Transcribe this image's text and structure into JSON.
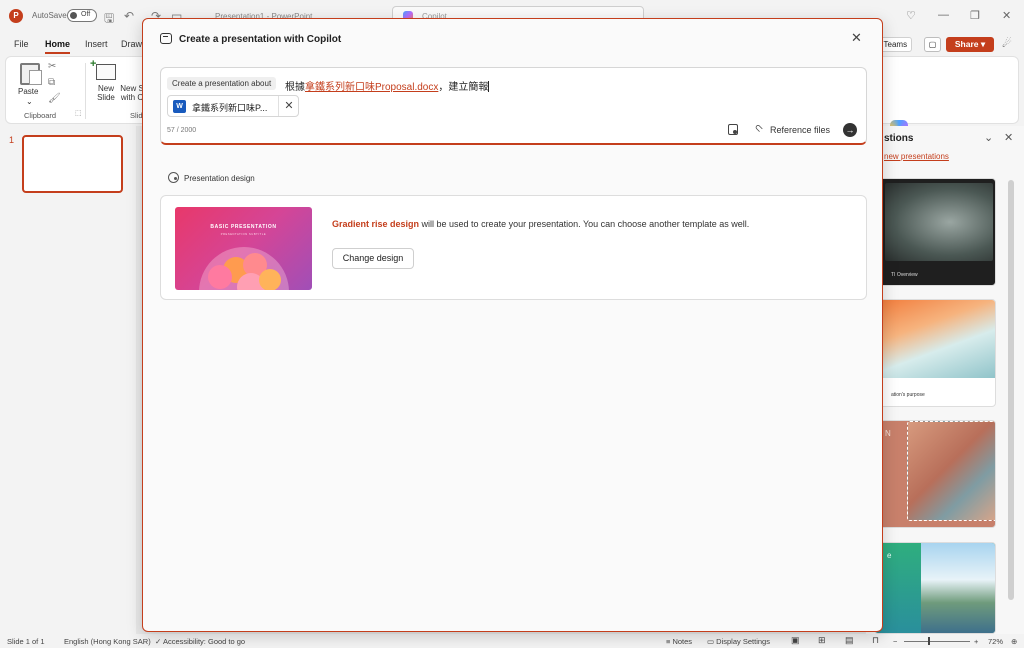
{
  "titlebar": {
    "app_logo": "P",
    "autosave_label": "AutoSave",
    "autosave_state": "Off",
    "doc_title": "Presentation1 - PowerPoint",
    "search_label": "Copilot",
    "icons": [
      "save-icon",
      "undo-icon",
      "redo-icon",
      "quick-access-icon",
      "lightbulb-icon",
      "minimize-icon",
      "restore-icon",
      "close-icon"
    ]
  },
  "ribbon": {
    "tabs": [
      "File",
      "Home",
      "Insert",
      "Draw"
    ],
    "active_tab": "Home",
    "paste_label": "Paste",
    "new_slide_label": "New Slide",
    "new_slide_copilot_label": "New S with C",
    "clipboard_group": "Clipboard",
    "slides_group": "Slid",
    "teams_label": "n Teams",
    "share_label": "Share",
    "copilot_label": "opilot"
  },
  "thumbnail_pane": {
    "slide_number": "1"
  },
  "designer": {
    "title": "stions",
    "link": "new presentations",
    "card1_caption": "TI Overview",
    "card2_caption": "ation's purpose",
    "card3_letter": "N",
    "card4_letter": "e"
  },
  "dialog": {
    "title": "Create a presentation with Copilot",
    "prompt_pill": "Create a presentation about",
    "prompt_prefix": "根據",
    "prompt_file_link": "拿鐵系列新口味Proposal.docx",
    "prompt_suffix": "，建立簡報",
    "attachment_name": "拿鐵系列新口味P...",
    "char_count": "57 / 2000",
    "reference_files_label": "Reference files",
    "section_label": "Presentation design",
    "design_name": "Gradient rise design",
    "design_text": " will be used to create your presentation. You can choose another template as well.",
    "change_design_label": "Change design",
    "thumb_title": "BASIC PRESENTATION",
    "thumb_subtitle": "PRESENTATION SUBTITLE",
    "accent_color": "#c43e1c"
  },
  "statusbar": {
    "slide_info": "Slide 1 of 1",
    "language": "English (Hong Kong SAR)",
    "accessibility": "Accessibility: Good to go",
    "notes_label": "Notes",
    "display_settings_label": "Display Settings",
    "zoom_level": "72%"
  }
}
